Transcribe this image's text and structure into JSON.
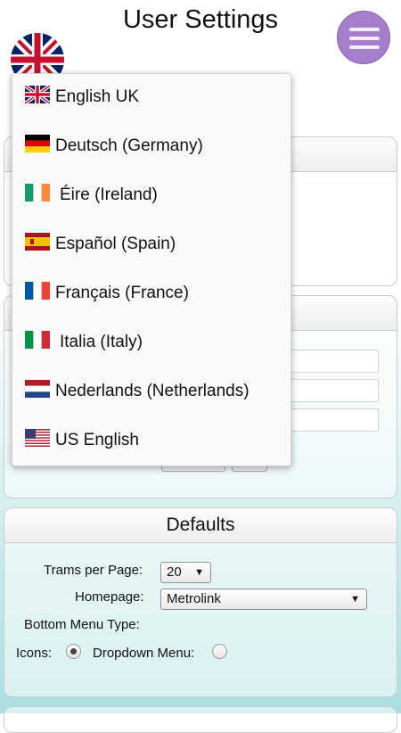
{
  "header": {
    "title": "User Settings",
    "menu_icon": "hamburger-icon",
    "current_flag": "uk-flag-icon"
  },
  "language_dropdown": {
    "options": [
      {
        "label": "English UK",
        "flag": "uk-flag-icon"
      },
      {
        "label": "Deutsch (Germany)",
        "flag": "germany-flag-icon"
      },
      {
        "label": "Éire (Ireland)",
        "flag": "ireland-flag-icon"
      },
      {
        "label": "Español (Spain)",
        "flag": "spain-flag-icon"
      },
      {
        "label": "Français (France)",
        "flag": "france-flag-icon"
      },
      {
        "label": "Italia (Italy)",
        "flag": "italy-flag-icon"
      },
      {
        "label": "Nederlands (Netherlands)",
        "flag": "netherlands-flag-icon"
      },
      {
        "label": "US English",
        "flag": "us-flag-icon"
      }
    ]
  },
  "defaults": {
    "heading": "Defaults",
    "trams_per_page_label": "Trams per Page:",
    "trams_per_page_value": "20",
    "homepage_label": "Homepage:",
    "homepage_value": "Metrolink",
    "bottom_menu_type_label": "Bottom Menu Type:",
    "icons_label": "Icons:",
    "icons_selected": true,
    "dropdown_menu_label": "Dropdown Menu:",
    "dropdown_menu_selected": false
  },
  "colors": {
    "menu_button": "#a57fcc",
    "background_bottom": "#a9dede"
  }
}
